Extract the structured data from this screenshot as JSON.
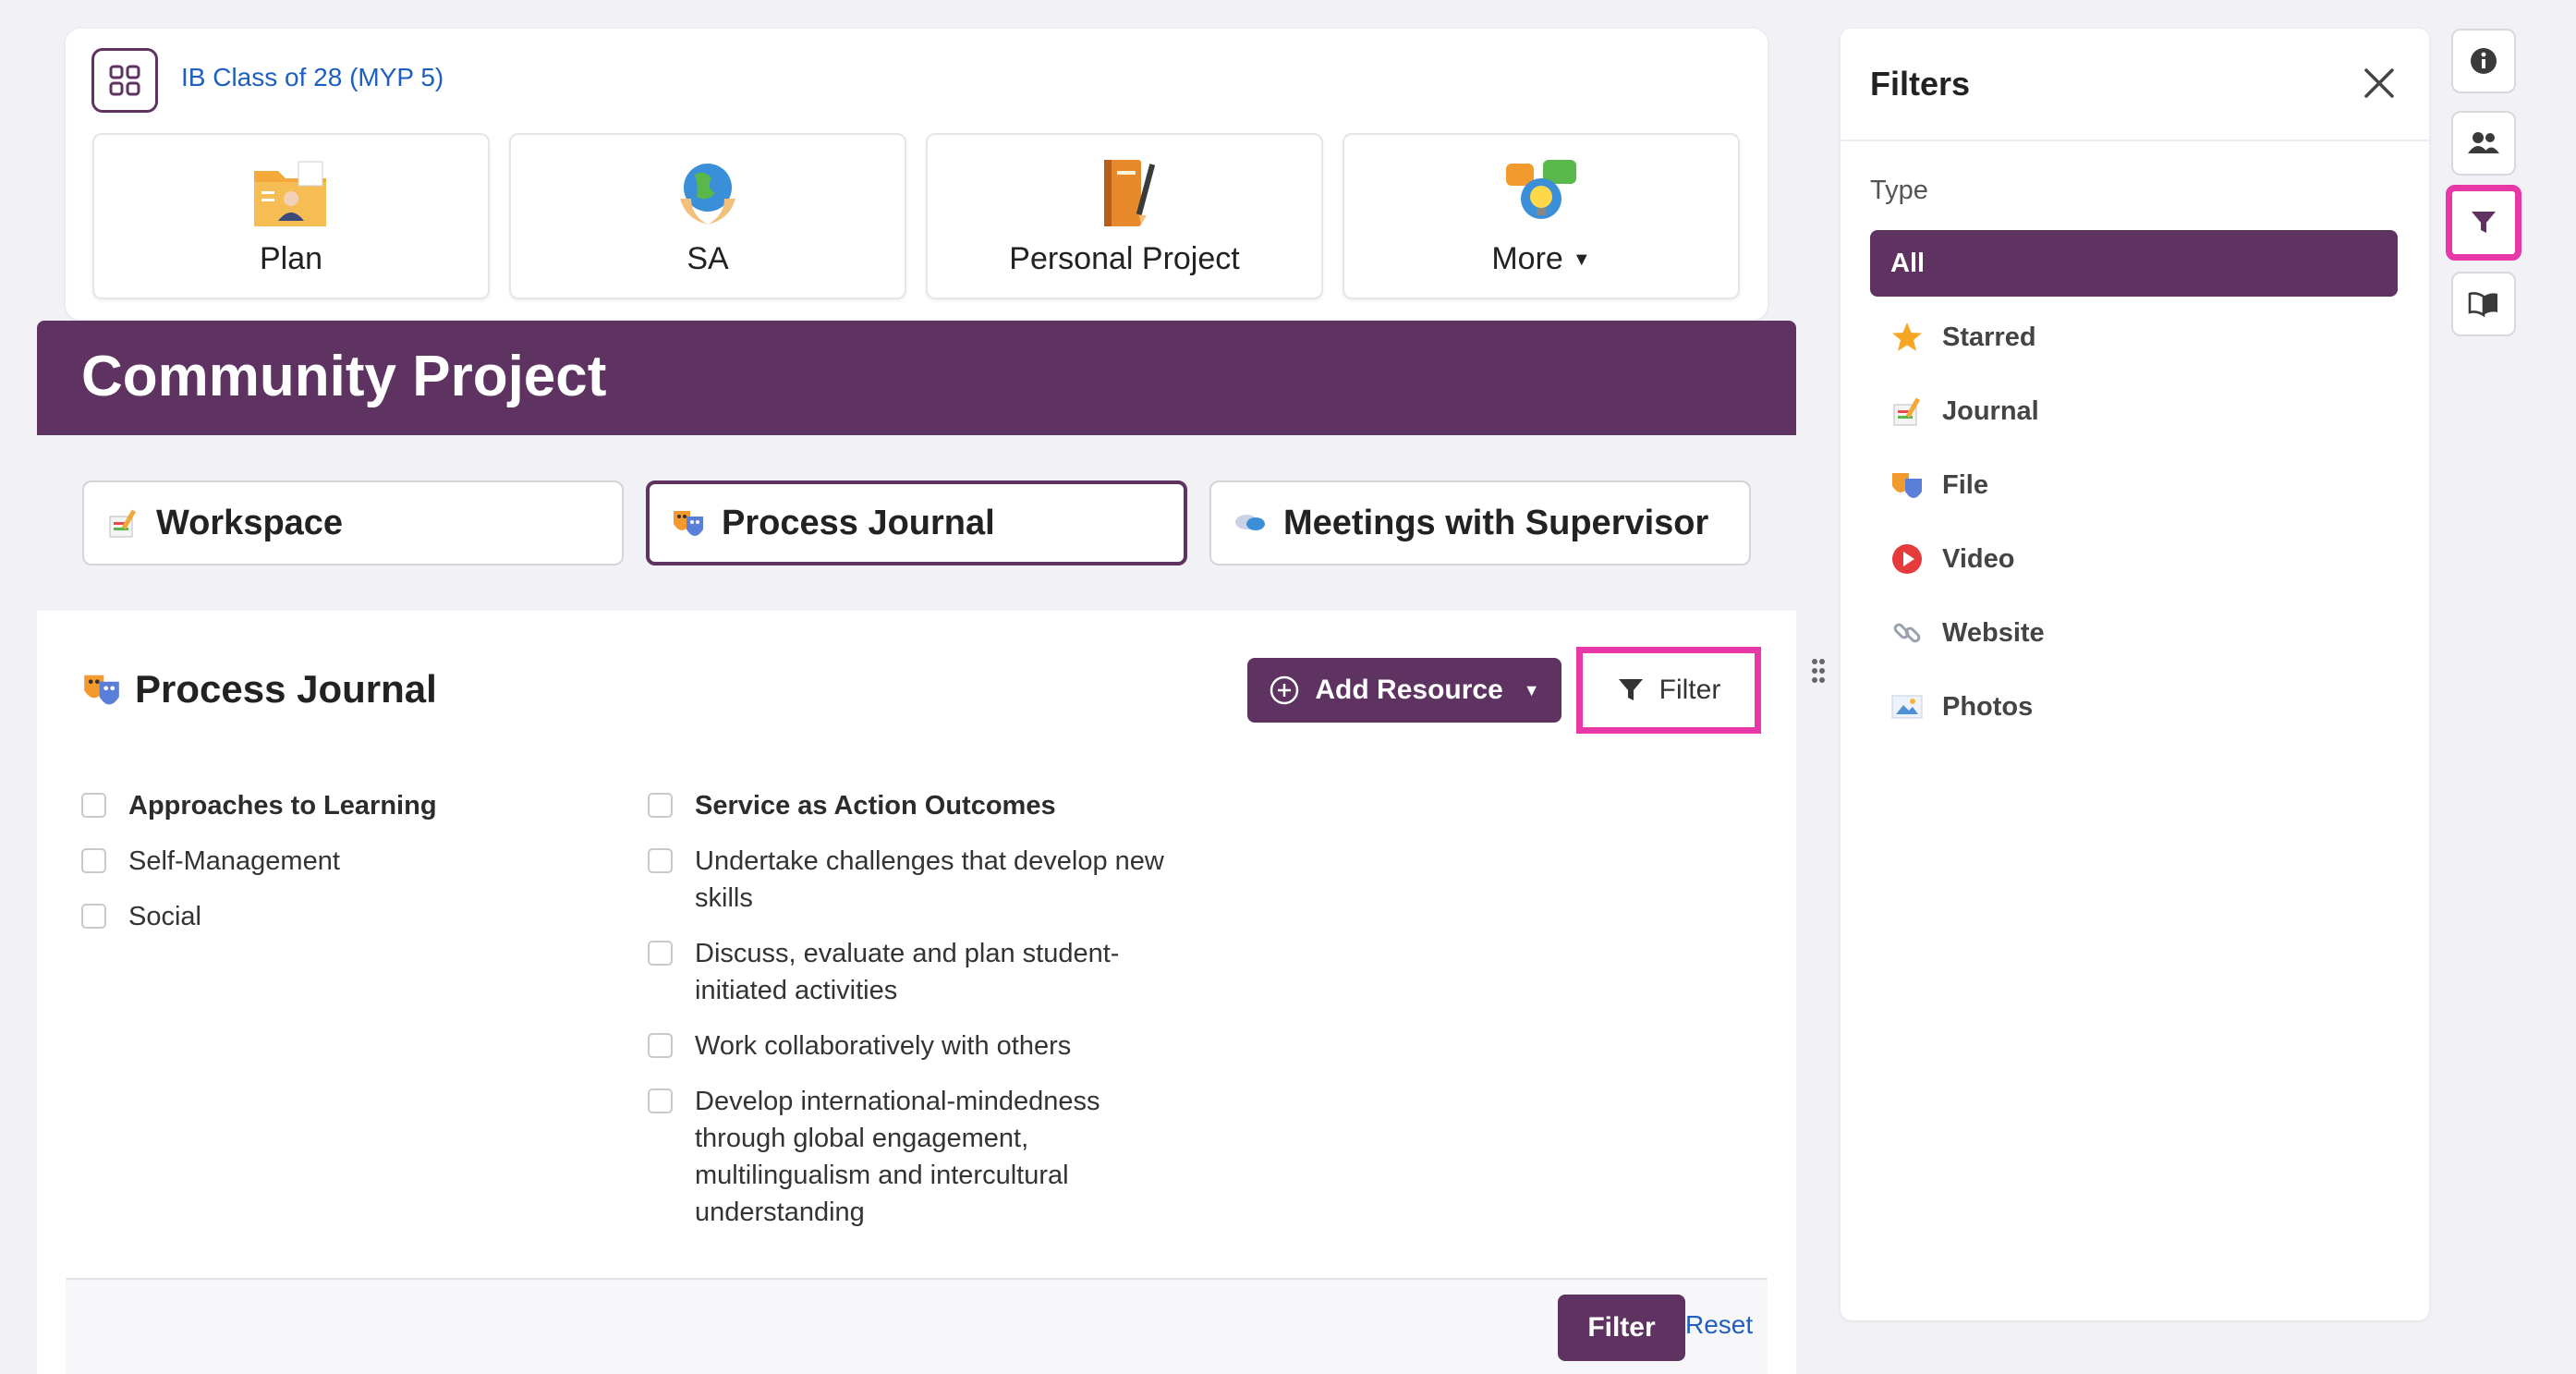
{
  "class_header": {
    "class_link": "IB Class of 28 (MYP 5)",
    "apps": [
      {
        "label": "Plan",
        "icon": "folder-user-icon"
      },
      {
        "label": "SA",
        "icon": "globe-hands-icon"
      },
      {
        "label": "Personal Project",
        "icon": "notebook-pencil-icon"
      },
      {
        "label": "More",
        "icon": "idea-chat-icon"
      }
    ]
  },
  "project": {
    "title": "Community Project",
    "tabs": [
      {
        "label": "Workspace",
        "icon": "journal-icon"
      },
      {
        "label": "Process Journal",
        "icon": "masks-icon"
      },
      {
        "label": "Meetings with Supervisor",
        "icon": "chat-bubbles-icon"
      }
    ]
  },
  "process_journal": {
    "heading": "Process Journal",
    "add_resource_label": "Add Resource",
    "filter_label": "Filter",
    "atl": {
      "title": "Approaches to Learning",
      "items": [
        "Self-Management",
        "Social"
      ]
    },
    "sa_outcomes": {
      "title": "Service as Action Outcomes",
      "items": [
        [
          "Undertake challenges that develop new",
          "skills"
        ],
        [
          "Discuss, evaluate and plan student-",
          "initiated activities"
        ],
        [
          "Work collaboratively with others"
        ],
        [
          "Develop international-mindedness",
          "through global engagement,",
          "multilingualism and intercultural",
          "understanding"
        ]
      ]
    },
    "footer": {
      "filter_label": "Filter",
      "reset_label": "Reset"
    }
  },
  "filters_panel": {
    "title": "Filters",
    "type_label": "Type",
    "types": [
      {
        "label": "All",
        "selected": true
      },
      {
        "label": "Starred",
        "icon": "star-icon"
      },
      {
        "label": "Journal",
        "icon": "journal-icon"
      },
      {
        "label": "File",
        "icon": "masks-icon"
      },
      {
        "label": "Video",
        "icon": "play-icon"
      },
      {
        "label": "Website",
        "icon": "link-icon"
      },
      {
        "label": "Photos",
        "icon": "photo-icon"
      }
    ]
  },
  "right_rail": [
    "info-icon",
    "users-icon",
    "filter-icon",
    "book-icon"
  ],
  "colors": {
    "brand_purple": "#5e3362",
    "highlight_pink": "#e838a8",
    "link_blue": "#1f5fbf",
    "page_bg": "#f2f2f6"
  }
}
